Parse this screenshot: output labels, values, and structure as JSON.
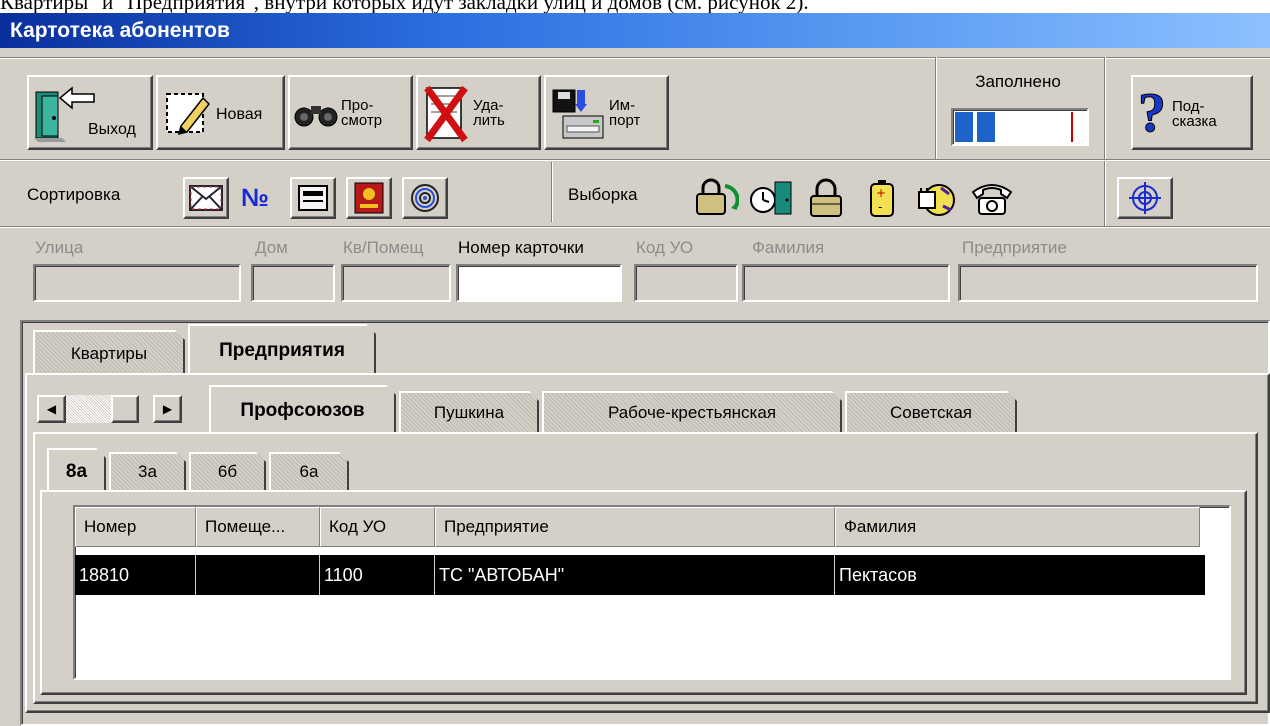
{
  "caption_top": "Квартиры\" и \"Предприятия\", внутри которых идут закладки улиц и домов (см. рисунок 2).",
  "window": {
    "title": "Картотека абонентов"
  },
  "toolbar": {
    "exit_label": "Выход",
    "new_label": "Новая",
    "view_label": "Про-\nсмотр",
    "delete_label": "Уда-\nлить",
    "import_label": "Им-\nпорт",
    "filled_label": "Заполнено",
    "help_label": "Под-\nсказка"
  },
  "sort": {
    "label": "Сортировка",
    "number_sign": "№"
  },
  "select": {
    "label": "Выборка"
  },
  "filters": {
    "street": {
      "label": "Улица",
      "value": ""
    },
    "house": {
      "label": "Дом",
      "value": ""
    },
    "apartment": {
      "label": "Кв/Помещ",
      "value": ""
    },
    "card_number": {
      "label": "Номер карточки",
      "value": ""
    },
    "uo_code": {
      "label": "Код УО",
      "value": ""
    },
    "surname": {
      "label": "Фамилия",
      "value": ""
    },
    "enterprise": {
      "label": "Предприятие",
      "value": ""
    }
  },
  "main_tabs": [
    {
      "label": "Квартиры",
      "active": false
    },
    {
      "label": "Предприятия",
      "active": true
    }
  ],
  "street_tabs": [
    {
      "label": "Профсоюзов",
      "active": true
    },
    {
      "label": "Пушкина",
      "active": false
    },
    {
      "label": "Рабоче-крестьянская",
      "active": false
    },
    {
      "label": "Советская",
      "active": false
    }
  ],
  "house_tabs": [
    {
      "label": "8а",
      "active": true
    },
    {
      "label": "3а",
      "active": false
    },
    {
      "label": "6б",
      "active": false
    },
    {
      "label": "6а",
      "active": false
    }
  ],
  "grid": {
    "columns": [
      "Номер",
      "Помеще...",
      "Код УО",
      "Предприятие",
      "Фамилия"
    ],
    "rows": [
      [
        "18810",
        "",
        "1100",
        "ТС \"АВТОБАН\"",
        "Пектасов"
      ]
    ]
  },
  "colors": {
    "title_start": "#0a2f9c",
    "title_end": "#8ec0ff",
    "face": "#d4d0c8",
    "selection": "#000000",
    "progress": "#1e64c8",
    "progress_mark": "#d00000"
  }
}
